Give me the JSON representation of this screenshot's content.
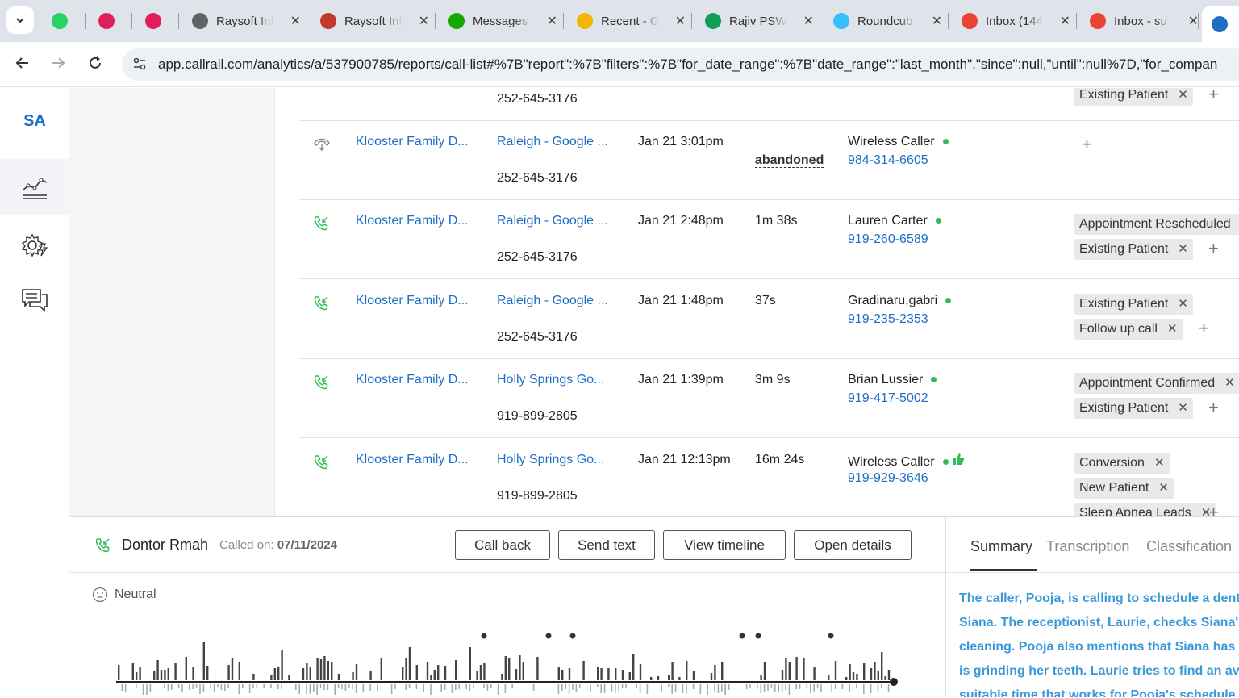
{
  "browser": {
    "tabs": [
      {
        "title": "",
        "icon": "whatsapp-icon",
        "color": "#25d366"
      },
      {
        "title": "",
        "icon": "slack-icon",
        "color": "#e01e5a"
      },
      {
        "title": "",
        "icon": "slack-icon",
        "color": "#e01e5a"
      },
      {
        "title": "Raysoft Inf",
        "icon": "globe-icon",
        "color": "#5f6368"
      },
      {
        "title": "Raysoft Inf",
        "icon": "raysoft-icon",
        "color": "#c0392b"
      },
      {
        "title": "Messages",
        "icon": "upwork-icon",
        "color": "#14a800"
      },
      {
        "title": "Recent - G",
        "icon": "google-drive-icon",
        "color": "#f4b400"
      },
      {
        "title": "Rajiv PSW",
        "icon": "google-sheets-icon",
        "color": "#0f9d58"
      },
      {
        "title": "Roundcub",
        "icon": "roundcube-icon",
        "color": "#37beff"
      },
      {
        "title": "Inbox (144",
        "icon": "gmail-icon",
        "color": "#ea4335"
      },
      {
        "title": "Inbox - su",
        "icon": "gmail-icon",
        "color": "#ea4335"
      },
      {
        "title": "",
        "icon": "callrail-icon",
        "color": "#1d6ec5"
      }
    ],
    "close_glyph": "✕",
    "url": "app.callrail.com/analytics/a/537900785/reports/call-list#%7B\"report\":%7B\"filters\":%7B\"for_date_range\":%7B\"date_range\":\"last_month\",\"since\":null,\"until\":null%7D,\"for_compan"
  },
  "app": {
    "logo": "SA"
  },
  "calls": [
    {
      "company": "",
      "source": "",
      "tracking_number": "252-645-3176",
      "date": "",
      "duration": "",
      "caller_name": "",
      "caller_number": "",
      "tags": [
        "Existing Patient"
      ]
    },
    {
      "direction": "abandoned",
      "company": "Klooster Family D...",
      "source": "Raleigh - Google ...",
      "tracking_number": "252-645-3176",
      "date": "Jan 21 3:01pm",
      "duration": "abandoned",
      "caller_name": "Wireless Caller",
      "caller_number": "984-314-6605",
      "tags": []
    },
    {
      "direction": "inbound",
      "company": "Klooster Family D...",
      "source": "Raleigh - Google ...",
      "tracking_number": "252-645-3176",
      "date": "Jan 21 2:48pm",
      "duration": "1m 38s",
      "caller_name": "Lauren Carter",
      "caller_number": "919-260-6589",
      "tags": [
        "Appointment Rescheduled",
        "Existing Patient"
      ]
    },
    {
      "direction": "inbound",
      "company": "Klooster Family D...",
      "source": "Raleigh - Google ...",
      "tracking_number": "252-645-3176",
      "date": "Jan 21 1:48pm",
      "duration": "37s",
      "caller_name": "Gradinaru,gabri",
      "caller_number": "919-235-2353",
      "tags": [
        "Existing Patient",
        "Follow up call"
      ]
    },
    {
      "direction": "inbound",
      "company": "Klooster Family D...",
      "source": "Holly Springs Go...",
      "tracking_number": "919-899-2805",
      "date": "Jan 21 1:39pm",
      "duration": "3m 9s",
      "caller_name": "Brian Lussier",
      "caller_number": "919-417-5002",
      "tags": [
        "Appointment Confirmed",
        "Existing Patient"
      ]
    },
    {
      "direction": "inbound",
      "company": "Klooster Family D...",
      "source": "Holly Springs Go...",
      "tracking_number": "919-899-2805",
      "date": "Jan 21 12:13pm",
      "duration": "16m 24s",
      "caller_name": "Wireless Caller",
      "caller_number": "919-929-3646",
      "tags": [
        "Conversion",
        "New Patient",
        "Sleep Apnea Leads"
      ]
    }
  ],
  "detail": {
    "caller_name": "Dontor Rmah",
    "called_on_label": "Called on:",
    "called_on_date": "07/11/2024",
    "buttons": {
      "call_back": "Call back",
      "send_text": "Send text",
      "view_timeline": "View timeline",
      "open_details": "Open details"
    },
    "sentiment": "Neutral"
  },
  "side_panel": {
    "tabs": [
      "Summary",
      "Transcription",
      "Classification"
    ],
    "active_tab": "Summary",
    "summary": "The caller, Pooja, is calling to schedule a dental cleaning for Siana. The receptionist, Laurie, checks Siana's records for cleaning. Pooja also mentions that Siana has lost a tooth and is grinding her teeth. Laurie tries to find an available slot and a suitable time that works for Pooja's schedule."
  },
  "colors": {
    "link": "#1d6ec5",
    "green_dot": "#2ebd5a",
    "summary_text": "#3a9ad9",
    "call_icon": "#2ebd5a"
  }
}
